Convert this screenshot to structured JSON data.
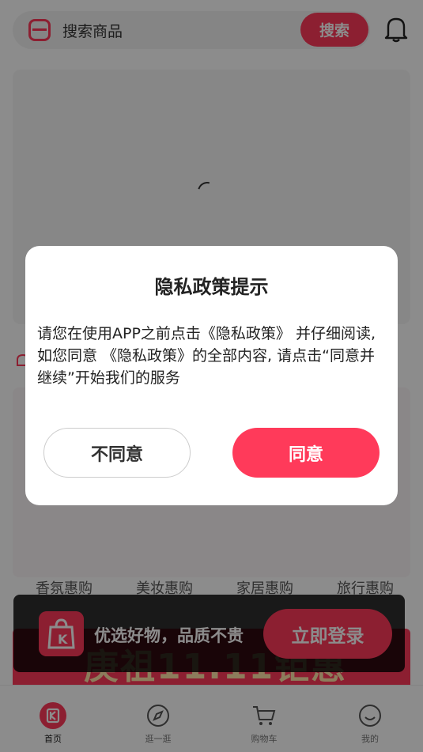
{
  "header": {
    "search_placeholder": "搜索商品",
    "search_button": "搜索",
    "logo_icon": "app-logo-icon",
    "bell_icon": "bell-icon"
  },
  "categories": [
    "香氛惠购",
    "美妆惠购",
    "家居惠购",
    "旅行惠购"
  ],
  "login_bar": {
    "slogan": "优选好物，品质不贵",
    "button": "立即登录"
  },
  "sale_banner": {
    "text": "庚祖11.11钜惠"
  },
  "tabbar": {
    "items": [
      {
        "label": "首页",
        "icon": "home-k-icon"
      },
      {
        "label": "逛一逛",
        "icon": "compass-icon"
      },
      {
        "label": "购物车",
        "icon": "cart-icon"
      },
      {
        "label": "我的",
        "icon": "smile-icon"
      }
    ]
  },
  "dialog": {
    "title": "隐私政策提示",
    "body": "请您在使用APP之前点击《隐私政策》 并仔细阅读, 如您同意 《隐私政策》的全部内容, 请点击“同意并继续”开始我们的服务",
    "disagree": "不同意",
    "agree": "同意"
  },
  "colors": {
    "accent": "#ff3a5a",
    "overlay": "rgba(0,0,0,0.45)"
  }
}
